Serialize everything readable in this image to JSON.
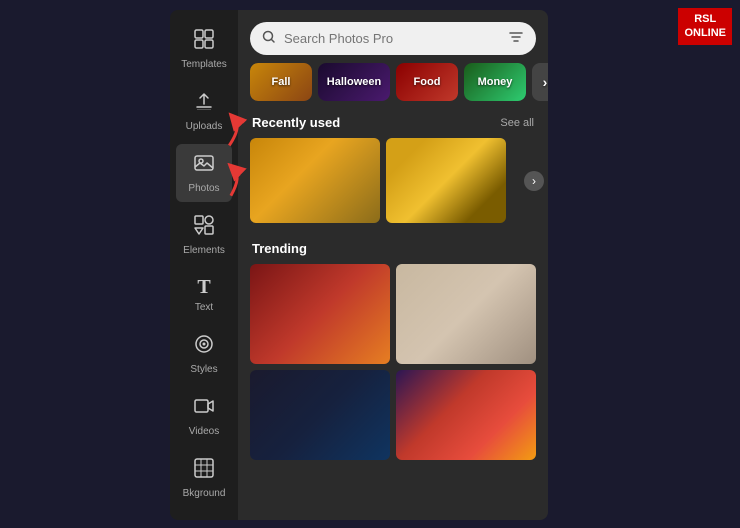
{
  "app": {
    "title": "Search Photos Pro"
  },
  "rsl_badge": {
    "line1": "RSL",
    "line2": "ONLINE"
  },
  "sidebar": {
    "items": [
      {
        "id": "templates",
        "label": "Templates",
        "icon": "⊞"
      },
      {
        "id": "uploads",
        "label": "Uploads",
        "icon": "↑"
      },
      {
        "id": "photos",
        "label": "Photos",
        "icon": "🖼"
      },
      {
        "id": "elements",
        "label": "Elements",
        "icon": "❖"
      },
      {
        "id": "text",
        "label": "Text",
        "icon": "T"
      },
      {
        "id": "styles",
        "label": "Styles",
        "icon": "◎"
      },
      {
        "id": "videos",
        "label": "Videos",
        "icon": "▶"
      },
      {
        "id": "bkground",
        "label": "Bkground",
        "icon": "▦"
      }
    ]
  },
  "search": {
    "placeholder": "Search Photos Pro",
    "filter_icon": "⚙"
  },
  "categories": [
    {
      "id": "fall",
      "label": "Fall",
      "bg_class": "pill-fall"
    },
    {
      "id": "halloween",
      "label": "Halloween",
      "bg_class": "pill-halloween"
    },
    {
      "id": "food",
      "label": "Food",
      "bg_class": "pill-food"
    },
    {
      "id": "money",
      "label": "Money",
      "bg_class": "pill-money"
    },
    {
      "id": "more",
      "label": "Co›",
      "bg_class": "pill-more"
    }
  ],
  "recently_used": {
    "title": "Recently used",
    "see_all": "See all"
  },
  "trending": {
    "title": "Trending"
  }
}
